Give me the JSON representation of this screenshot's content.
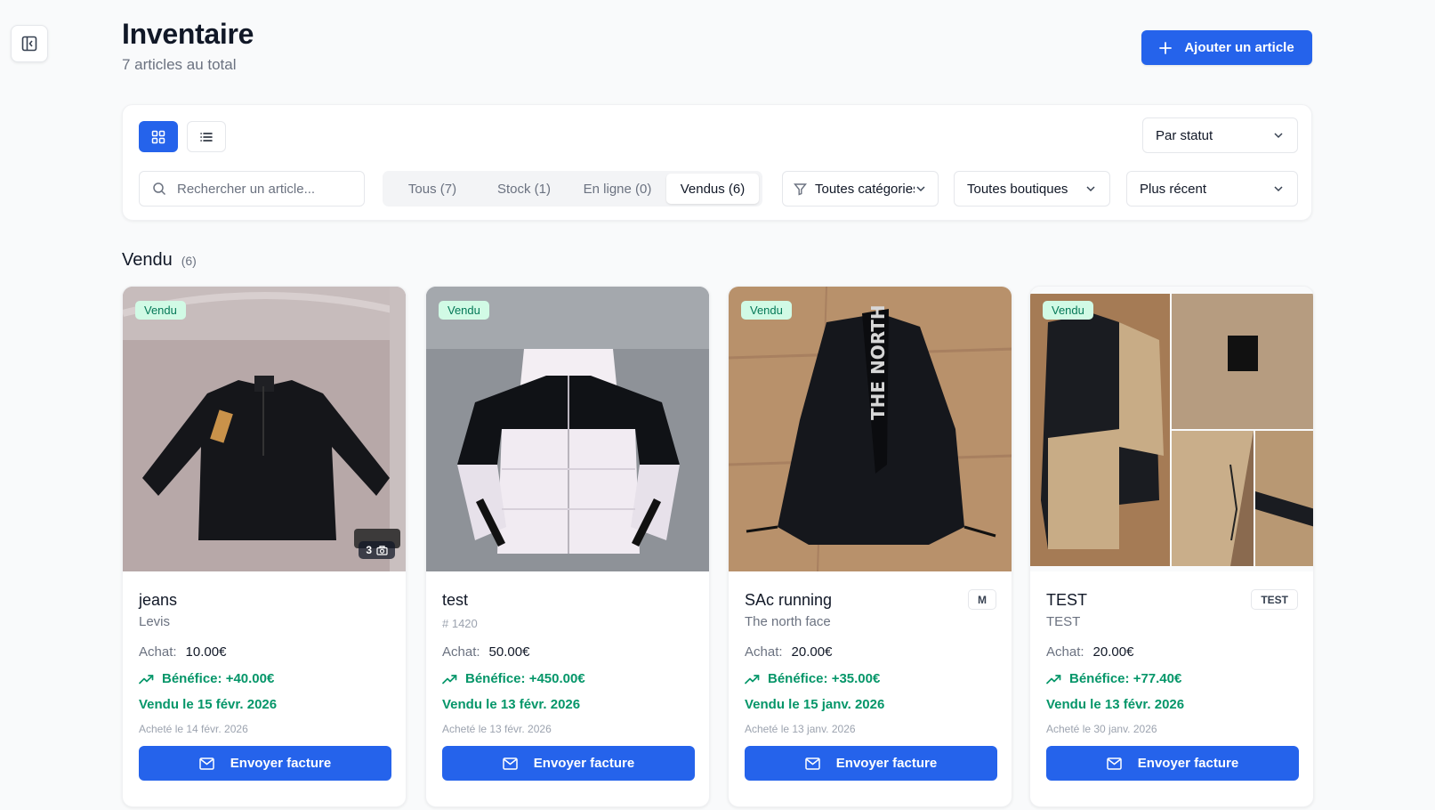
{
  "header": {
    "title": "Inventaire",
    "subtitle": "7 articles au total",
    "add_label": "Ajouter un article"
  },
  "filters": {
    "group_by": "Par statut",
    "search_placeholder": "Rechercher un article...",
    "tabs": [
      {
        "label": "Tous (7)",
        "active": false
      },
      {
        "label": "Stock (1)",
        "active": false
      },
      {
        "label": "En ligne (0)",
        "active": false
      },
      {
        "label": "Vendus (6)",
        "active": true
      }
    ],
    "category": "Toutes catégories",
    "shops": "Toutes boutiques",
    "sort": "Plus récent"
  },
  "section": {
    "title": "Vendu",
    "count": "(6)"
  },
  "cards": [
    {
      "badge": "Vendu",
      "photos": "3",
      "title": "jeans",
      "brand": "Levis",
      "ref": "",
      "size": "",
      "achat_label": "Achat:",
      "achat": "10.00€",
      "profit": "Bénéfice: +40.00€",
      "sold": "Vendu le 15 févr. 2026",
      "bought": "Acheté le 14 févr. 2026",
      "invoice": "Envoyer facture"
    },
    {
      "badge": "Vendu",
      "photos": "",
      "title": "test",
      "brand": "",
      "ref": "# 1420",
      "size": "",
      "achat_label": "Achat:",
      "achat": "50.00€",
      "profit": "Bénéfice: +450.00€",
      "sold": "Vendu le 13 févr. 2026",
      "bought": "Acheté le 13 févr. 2026",
      "invoice": "Envoyer facture"
    },
    {
      "badge": "Vendu",
      "photos": "",
      "title": "SAc running",
      "brand": "The north face",
      "ref": "",
      "size": "M",
      "achat_label": "Achat:",
      "achat": "20.00€",
      "profit": "Bénéfice: +35.00€",
      "sold": "Vendu le 15 janv. 2026",
      "bought": "Acheté le 13 janv. 2026",
      "invoice": "Envoyer facture"
    },
    {
      "badge": "Vendu",
      "photos": "",
      "title": "TEST",
      "brand": "TEST",
      "ref": "",
      "size": "TEST",
      "achat_label": "Achat:",
      "achat": "20.00€",
      "profit": "Bénéfice: +77.40€",
      "sold": "Vendu le 13 févr. 2026",
      "bought": "Acheté le 30 janv. 2026",
      "invoice": "Envoyer facture"
    }
  ]
}
